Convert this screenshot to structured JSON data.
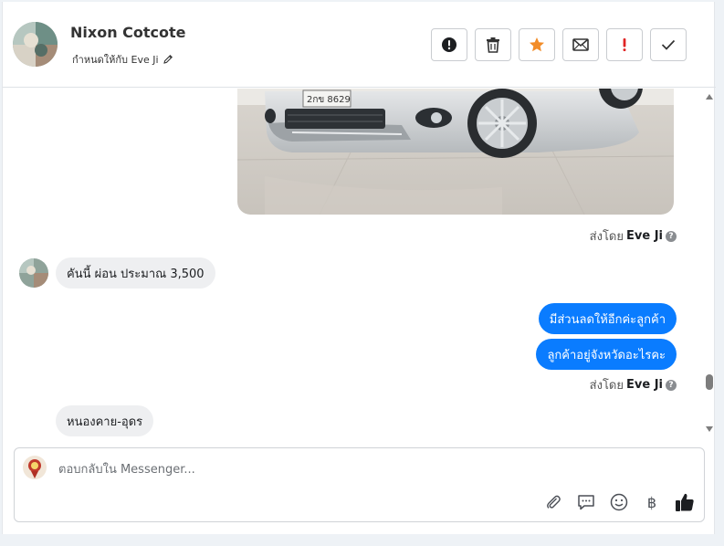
{
  "header": {
    "contact_name": "Nixon Cotcote",
    "assign_label": "กำหนดให้กับ Eve Ji",
    "actions": [
      {
        "icon": "alert-circle-icon"
      },
      {
        "icon": "trash-icon"
      },
      {
        "icon": "star-icon",
        "color": "#f28c28"
      },
      {
        "icon": "envelope-icon"
      },
      {
        "icon": "exclamation-icon",
        "color": "#e02424"
      },
      {
        "icon": "check-icon"
      }
    ]
  },
  "chat": {
    "sent_by_1": {
      "prefix": "ส่งโดย",
      "name": "Eve Ji"
    },
    "incoming_1": "คันนี้ ผ่อน ประมาณ 3,500",
    "outgoing_1": "มีส่วนลดให้อีกค่ะลูกค้า",
    "outgoing_2": "ลูกค้าอยู่จังหวัดอะไรคะ",
    "sent_by_2": {
      "prefix": "ส่งโดย",
      "name": "Eve Ji"
    },
    "incoming_2": "หนองคาย-อุดร"
  },
  "composer": {
    "placeholder": "ตอบกลับใน Messenger...",
    "baht_symbol": "฿"
  },
  "colors": {
    "accent_blue": "#0a7cff",
    "star_orange": "#f28c28",
    "alert_red": "#e02424"
  }
}
